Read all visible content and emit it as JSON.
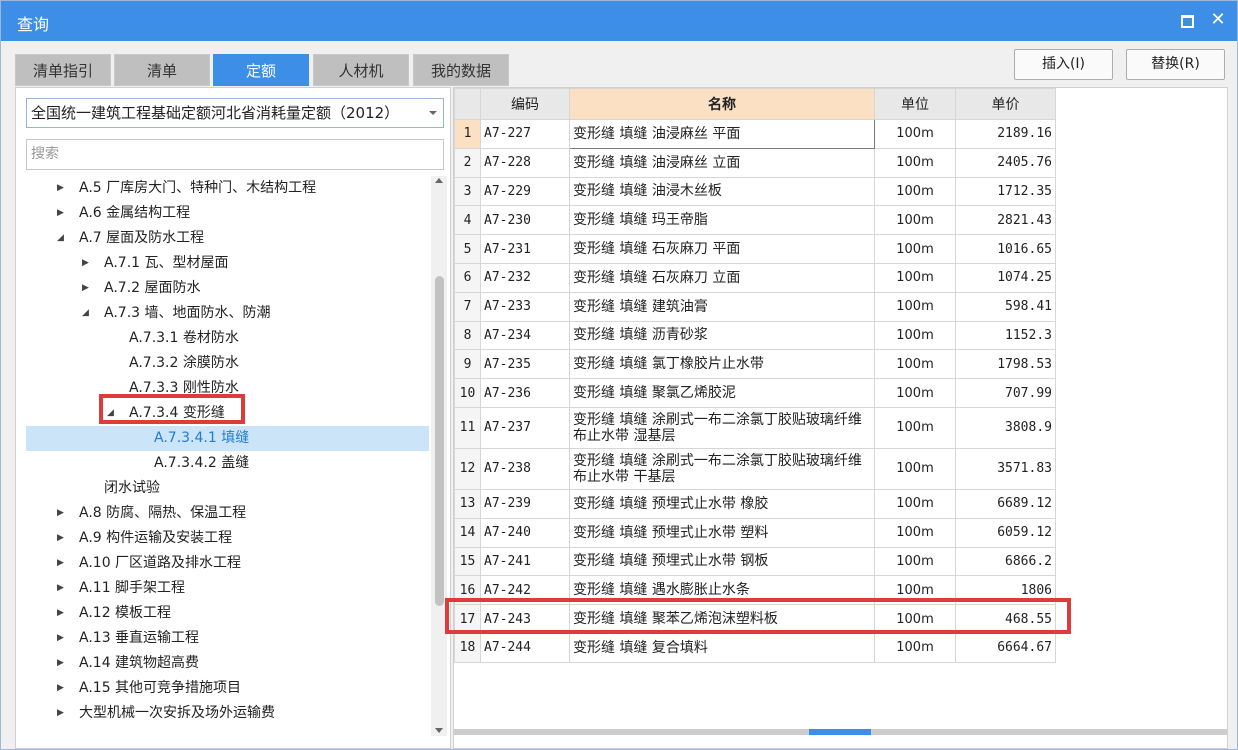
{
  "window": {
    "title": "查询"
  },
  "tabs": [
    {
      "label": "清单指引"
    },
    {
      "label": "清单"
    },
    {
      "label": "定额"
    },
    {
      "label": "人材机"
    },
    {
      "label": "我的数据"
    }
  ],
  "buttons": {
    "insert": "插入(I)",
    "replace": "替换(R)"
  },
  "left": {
    "quota_select": "全国统一建筑工程基础定额河北省消耗量定额（2012）",
    "search_placeholder": "搜索",
    "tree": [
      {
        "label": "A.5 厂库房大门、特种门、木结构工程",
        "expander": "collapsed"
      },
      {
        "label": "A.6 金属结构工程",
        "expander": "collapsed"
      },
      {
        "label": "A.7 屋面及防水工程",
        "expander": "expanded"
      },
      {
        "label": "A.7.1 瓦、型材屋面",
        "expander": "collapsed"
      },
      {
        "label": "A.7.2 屋面防水",
        "expander": "collapsed"
      },
      {
        "label": "A.7.3 墙、地面防水、防潮",
        "expander": "expanded"
      },
      {
        "label": "A.7.3.1 卷材防水",
        "expander": "none"
      },
      {
        "label": "A.7.3.2 涂膜防水",
        "expander": "none"
      },
      {
        "label": "A.7.3.3 刚性防水",
        "expander": "none"
      },
      {
        "label": "A.7.3.4 变形缝",
        "expander": "expanded",
        "highlight": true
      },
      {
        "label": "A.7.3.4.1 填缝",
        "expander": "none",
        "selected": true
      },
      {
        "label": "A.7.3.4.2 盖缝",
        "expander": "none"
      },
      {
        "label": "闭水试验",
        "expander": "none"
      },
      {
        "label": "A.8 防腐、隔热、保温工程",
        "expander": "collapsed"
      },
      {
        "label": "A.9 构件运输及安装工程",
        "expander": "collapsed"
      },
      {
        "label": "A.10 厂区道路及排水工程",
        "expander": "collapsed"
      },
      {
        "label": "A.11 脚手架工程",
        "expander": "collapsed"
      },
      {
        "label": "A.12 模板工程",
        "expander": "collapsed"
      },
      {
        "label": "A.13 垂直运输工程",
        "expander": "collapsed"
      },
      {
        "label": "A.14 建筑物超高费",
        "expander": "collapsed"
      },
      {
        "label": "A.15 其他可竞争措施项目",
        "expander": "collapsed"
      },
      {
        "label": "大型机械一次安拆及场外运输费",
        "expander": "collapsed"
      }
    ]
  },
  "table": {
    "columns": {
      "code": "编码",
      "name": "名称",
      "unit": "单位",
      "price": "单价"
    },
    "rows": [
      {
        "n": "1",
        "code": "A7-227",
        "name": "变形缝 填缝 油浸麻丝 平面",
        "unit": "100m",
        "price": "2189.16"
      },
      {
        "n": "2",
        "code": "A7-228",
        "name": "变形缝 填缝 油浸麻丝 立面",
        "unit": "100m",
        "price": "2405.76"
      },
      {
        "n": "3",
        "code": "A7-229",
        "name": "变形缝 填缝 油浸木丝板",
        "unit": "100m",
        "price": "1712.35"
      },
      {
        "n": "4",
        "code": "A7-230",
        "name": "变形缝 填缝 玛王帝脂",
        "unit": "100m",
        "price": "2821.43"
      },
      {
        "n": "5",
        "code": "A7-231",
        "name": "变形缝 填缝 石灰麻刀 平面",
        "unit": "100m",
        "price": "1016.65"
      },
      {
        "n": "6",
        "code": "A7-232",
        "name": "变形缝 填缝 石灰麻刀 立面",
        "unit": "100m",
        "price": "1074.25"
      },
      {
        "n": "7",
        "code": "A7-233",
        "name": "变形缝 填缝 建筑油膏",
        "unit": "100m",
        "price": "598.41"
      },
      {
        "n": "8",
        "code": "A7-234",
        "name": "变形缝 填缝 沥青砂浆",
        "unit": "100m",
        "price": "1152.3"
      },
      {
        "n": "9",
        "code": "A7-235",
        "name": "变形缝 填缝 氯丁橡胶片止水带",
        "unit": "100m",
        "price": "1798.53"
      },
      {
        "n": "10",
        "code": "A7-236",
        "name": "变形缝 填缝 聚氯乙烯胶泥",
        "unit": "100m",
        "price": "707.99"
      },
      {
        "n": "11",
        "code": "A7-237",
        "name": "变形缝 填缝 涂刷式一布二涂氯丁胶贴玻璃纤维布止水带 湿基层",
        "unit": "100m",
        "price": "3808.9",
        "tall": true
      },
      {
        "n": "12",
        "code": "A7-238",
        "name": "变形缝 填缝 涂刷式一布二涂氯丁胶贴玻璃纤维布止水带 干基层",
        "unit": "100m",
        "price": "3571.83",
        "tall": true
      },
      {
        "n": "13",
        "code": "A7-239",
        "name": "变形缝 填缝 预埋式止水带 橡胶",
        "unit": "100m",
        "price": "6689.12"
      },
      {
        "n": "14",
        "code": "A7-240",
        "name": "变形缝 填缝 预埋式止水带 塑料",
        "unit": "100m",
        "price": "6059.12"
      },
      {
        "n": "15",
        "code": "A7-241",
        "name": "变形缝 填缝 预埋式止水带 钢板",
        "unit": "100m",
        "price": "6866.2"
      },
      {
        "n": "16",
        "code": "A7-242",
        "name": "变形缝 填缝 遇水膨胀止水条",
        "unit": "100m",
        "price": "1806"
      },
      {
        "n": "17",
        "code": "A7-243",
        "name": "变形缝 填缝 聚苯乙烯泡沫塑料板",
        "unit": "100m",
        "price": "468.55",
        "highlight": true
      },
      {
        "n": "18",
        "code": "A7-244",
        "name": "变形缝 填缝 复合填料",
        "unit": "100m",
        "price": "6664.67"
      }
    ]
  },
  "colors": {
    "accent": "#3d8ee7",
    "header_highlight": "#fbe0c3",
    "annotation_red": "#e03b3b",
    "tree_selected": "#cce4f7"
  }
}
